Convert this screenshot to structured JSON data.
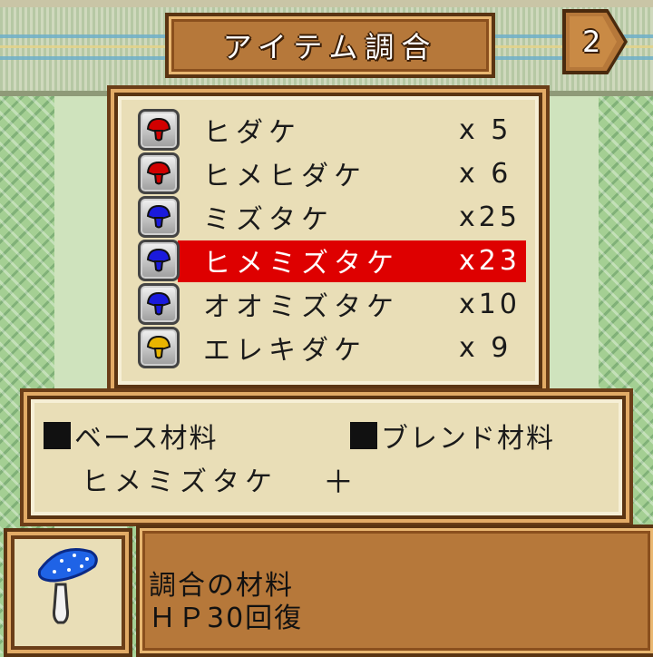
{
  "title": "アイテム調合",
  "page_number": "2",
  "items": [
    {
      "name": "ヒダケ",
      "qty": "x 5",
      "icon": "red-mushroom-icon",
      "color": "#d20000"
    },
    {
      "name": "ヒメヒダケ",
      "qty": "x 6",
      "icon": "red-mushroom-icon",
      "color": "#d20000"
    },
    {
      "name": "ミズタケ",
      "qty": "x25",
      "icon": "blue-mushroom-icon",
      "color": "#1a1adc"
    },
    {
      "name": "ヒメミズタケ",
      "qty": "x23",
      "icon": "blue-mushroom-icon",
      "color": "#1a1adc",
      "selected": true
    },
    {
      "name": "オオミズタケ",
      "qty": "x10",
      "icon": "blue-mushroom-icon",
      "color": "#1a1adc"
    },
    {
      "name": "エレキダケ",
      "qty": "x 9",
      "icon": "yellow-mushroom-icon",
      "color": "#e8b400"
    }
  ],
  "materials": {
    "base_label": "ベース材料",
    "blend_label": "ブレンド材料",
    "base_value": "ヒメミズタケ",
    "plus": "＋"
  },
  "description": {
    "line1": "調合の材料",
    "line2": "ＨＰ30回復"
  },
  "colors": {
    "selection": "#de0000",
    "wood": "#b6783a",
    "panel": "#e9deb7"
  }
}
